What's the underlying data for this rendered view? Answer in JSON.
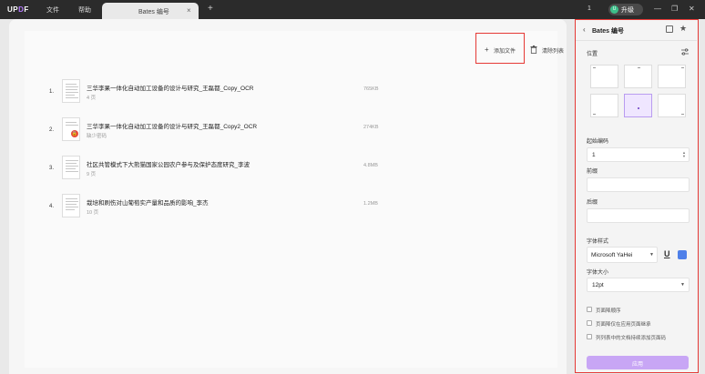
{
  "app": {
    "logo": "UPDF",
    "menu": [
      "文件",
      "帮助"
    ]
  },
  "tab": {
    "title": "Bates 编号",
    "close": "×",
    "add": "+"
  },
  "window": {
    "version": "1",
    "upgrade_label": "升级",
    "avatar_initial": "U",
    "min": "—",
    "restore": "❐",
    "close": "✕"
  },
  "toolbar": {
    "add_files": "添加文件",
    "clear_list": "清除列表"
  },
  "files": [
    {
      "index": "1.",
      "name": "三华李果一体化自动加工设备的设计与研究_王磊都_Copy_OCR",
      "sub": "4 页",
      "size": "765KB",
      "locked": false
    },
    {
      "index": "2.",
      "name": "三华李果一体化自动加工设备的设计与研究_王磊都_Copy2_OCR",
      "sub": "缺少密码",
      "size": "274KB",
      "locked": true
    },
    {
      "index": "3.",
      "name": "社区共管模式下大熊猫国家公园农户参与及保护态度研究_李波",
      "sub": "9 页",
      "size": "4.8MB",
      "locked": false
    },
    {
      "index": "4.",
      "name": "栽培和刷伤对山葡萄实产量和品质的影响_李杰",
      "sub": "10 页",
      "size": "1.2MB",
      "locked": false
    }
  ],
  "panel": {
    "title": "Bates 编号",
    "position_label": "位置",
    "position_selected": "bottom-center",
    "start_number_label": "起始编码",
    "start_number_value": "1",
    "prefix_label": "前缀",
    "prefix_value": "",
    "suffix_label": "后缀",
    "suffix_value": "",
    "font_style_label": "字体样式",
    "font_name": "Microsoft YaHei",
    "font_color": "#4f80e9",
    "font_size_label": "字体大小",
    "font_size_value": "12pt",
    "options": [
      "页面降顺序",
      "页面降仅在应用页面继承",
      "列列表中的文档持续添加页面码"
    ],
    "apply_label": "应用"
  }
}
